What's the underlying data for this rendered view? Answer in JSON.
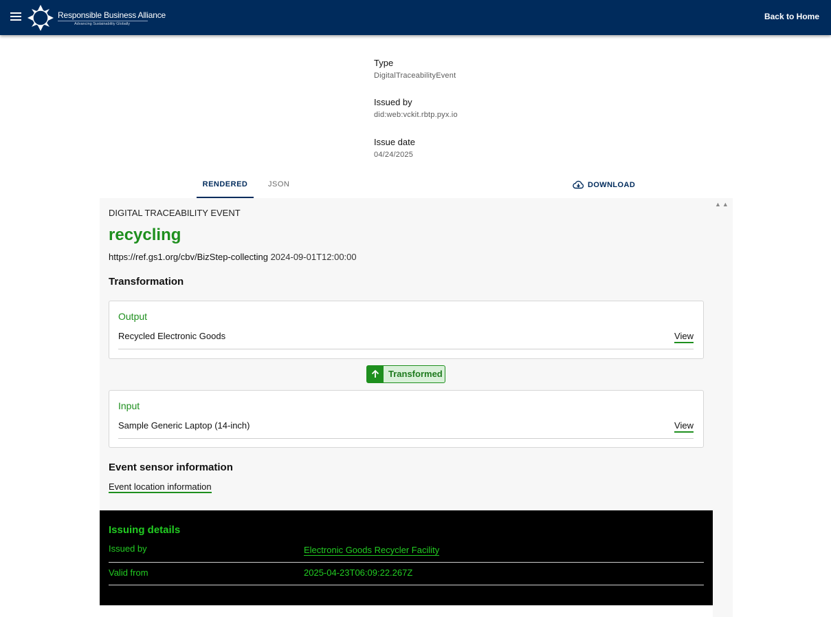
{
  "header": {
    "org_name": "Responsible Business Alliance",
    "org_tagline": "Advancing Sustainability Globally",
    "back_home_label": "Back to Home"
  },
  "meta": {
    "type_label": "Type",
    "type_value": "DigitalTraceabilityEvent",
    "issued_by_label": "Issued by",
    "issued_by_value": "did:web:vckit.rbtp.pyx.io",
    "issue_date_label": "Issue date",
    "issue_date_value": "04/24/2025"
  },
  "tabs": [
    {
      "label": "RENDERED",
      "active": true
    },
    {
      "label": "JSON",
      "active": false
    }
  ],
  "download_label": "DOWNLOAD",
  "event": {
    "kind": "DIGITAL TRACEABILITY EVENT",
    "title": "recycling",
    "biz_step": "https://ref.gs1.org/cbv/BizStep-collecting",
    "event_time": "2024-09-01T12:00:00",
    "transformation_heading": "Transformation",
    "output": {
      "title": "Output",
      "item": "Recycled Electronic Goods",
      "view_label": "View"
    },
    "transformed_label": "Transformed",
    "input": {
      "title": "Input",
      "item": "Sample Generic Laptop (14-inch)",
      "view_label": "View"
    },
    "sensor_heading": "Event sensor information",
    "location_link": "Event location information"
  },
  "issuing": {
    "title": "Issuing details",
    "issued_by_label": "Issued by",
    "issued_by_value": "Electronic Goods Recycler Facility",
    "valid_from_label": "Valid from",
    "valid_from_value": "2025-04-23T06:09:22.267Z"
  },
  "colors": {
    "header_bg": "#002b5c",
    "accent_green": "#1e8f1e",
    "issuing_green": "#22cc22"
  }
}
